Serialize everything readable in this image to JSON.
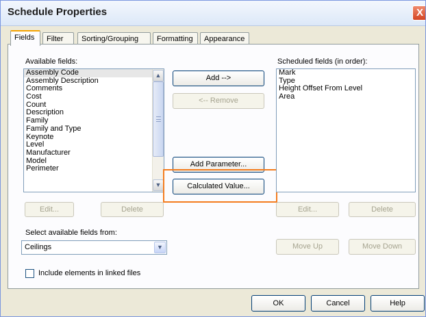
{
  "window": {
    "title": "Schedule Properties",
    "close_label": "X"
  },
  "tabs": [
    {
      "label": "Fields",
      "active": true
    },
    {
      "label": "Filter",
      "active": false
    },
    {
      "label": "Sorting/Grouping",
      "active": false
    },
    {
      "label": "Formatting",
      "active": false
    },
    {
      "label": "Appearance",
      "active": false
    }
  ],
  "available": {
    "label": "Available fields:",
    "items": [
      "Assembly Code",
      "Assembly Description",
      "Comments",
      "Cost",
      "Count",
      "Description",
      "Family",
      "Family and Type",
      "Keynote",
      "Level",
      "Manufacturer",
      "Model",
      "Perimeter"
    ],
    "selected": "Assembly Code",
    "edit_label": "Edit...",
    "delete_label": "Delete"
  },
  "middle": {
    "add_label": "Add -->",
    "remove_label": "<-- Remove",
    "add_parameter_label": "Add Parameter...",
    "calculated_value_label": "Calculated Value..."
  },
  "scheduled": {
    "label": "Scheduled fields (in order):",
    "items": [
      "Mark",
      "Type",
      "Height Offset From Level",
      "Area"
    ],
    "edit_label": "Edit...",
    "delete_label": "Delete",
    "move_up_label": "Move Up",
    "move_down_label": "Move Down"
  },
  "select_from": {
    "label": "Select available fields from:",
    "value": "Ceilings"
  },
  "linked_files": {
    "label": "Include elements in linked files",
    "checked": false
  },
  "footer": {
    "ok_label": "OK",
    "cancel_label": "Cancel",
    "help_label": "Help"
  },
  "colors": {
    "highlight": "#f47c1d",
    "active_tab_accent": "#f5a300",
    "button_border": "#003c74"
  },
  "icons": {
    "scroll_up": "chevron-up-icon",
    "scroll_down": "chevron-down-icon",
    "combo": "chevron-down-icon"
  }
}
